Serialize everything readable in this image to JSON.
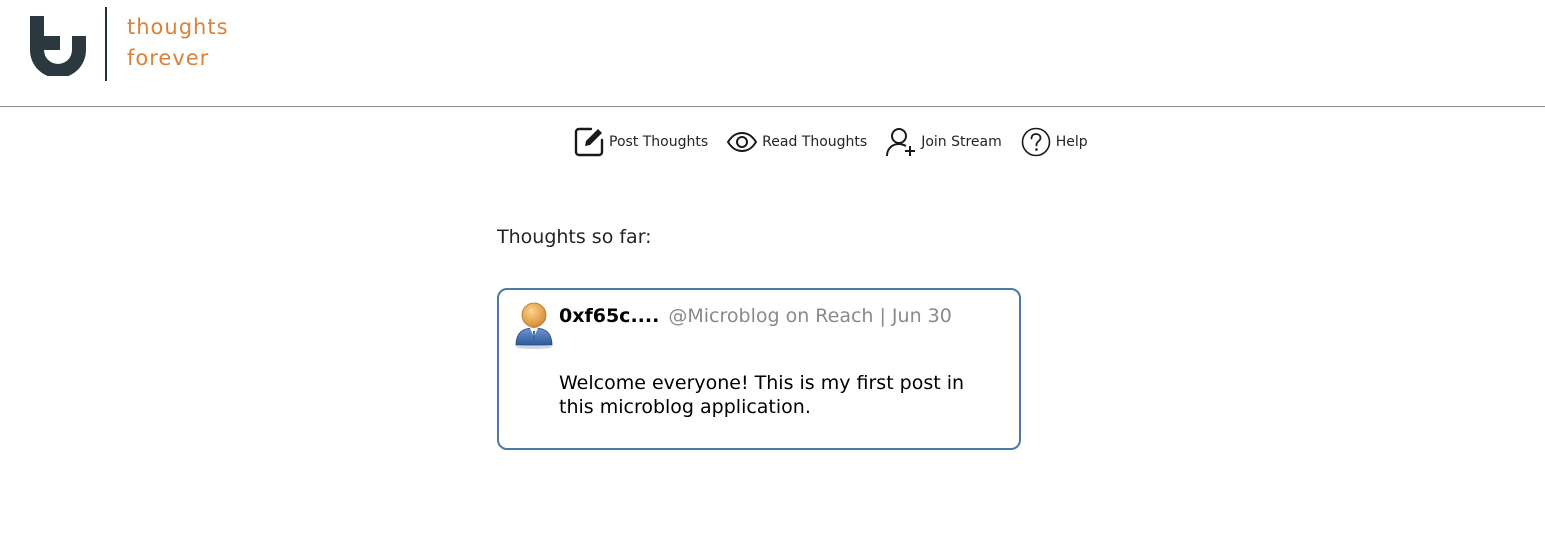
{
  "brand": {
    "line1": "thoughts",
    "line2": "forever",
    "text_color": "#d9823c",
    "mark_color": "#2b3840"
  },
  "nav": {
    "items": [
      {
        "label": "Post Thoughts",
        "icon": "edit-icon"
      },
      {
        "label": "Read Thoughts",
        "icon": "eye-icon"
      },
      {
        "label": "Join Stream",
        "icon": "add-user-icon"
      },
      {
        "label": "Help",
        "icon": "help-icon"
      }
    ]
  },
  "main": {
    "section_title": "Thoughts so far:",
    "posts": [
      {
        "author": "0xf65c....",
        "source": "@Microblog on Reach | Jun 30",
        "body": "Welcome everyone! This is my first post in this microblog application.",
        "avatar_icon": "user-avatar-icon"
      }
    ]
  },
  "colors": {
    "card_border": "#4a7aa8",
    "muted_text": "#8a8a8a",
    "header_rule": "#8a8a8a"
  }
}
